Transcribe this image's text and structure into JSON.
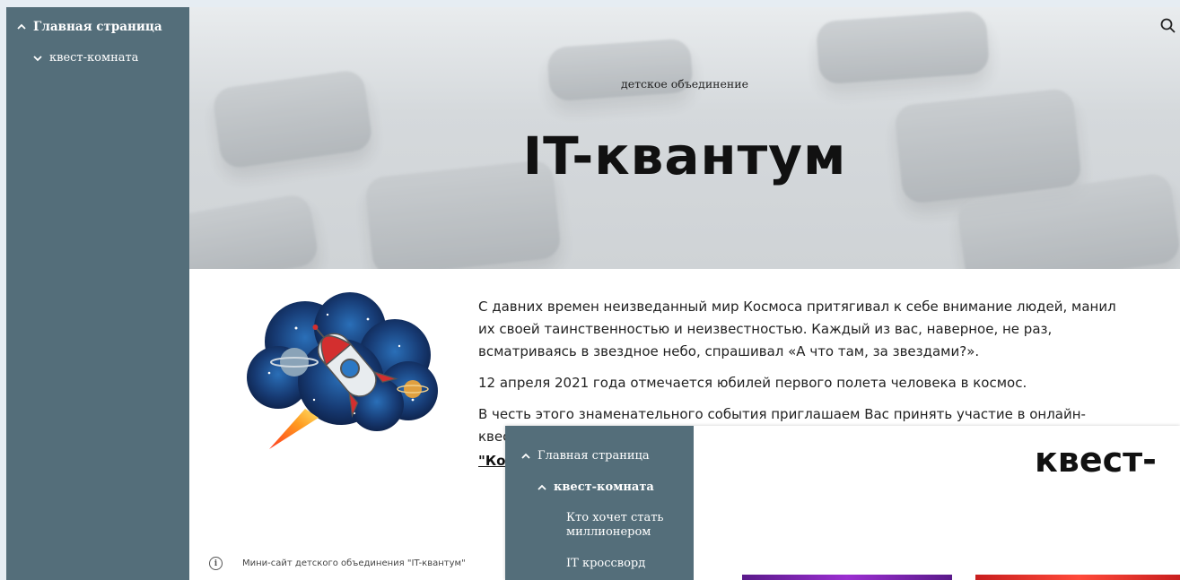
{
  "sidebar": {
    "home_label": "Главная страница",
    "quest_label": "квест-комната"
  },
  "hero": {
    "subtitle": "детское объединение",
    "title": "IT-квантум"
  },
  "content": {
    "paragraph1": "С давних времен неизведанный мир Космоса притягивал к себе внимание людей, манил их своей таинственностью и неизвестностью. Каждый из вас, наверное, не раз, всматриваясь в звездное небо, спрашивал «А что там, за звездами?».",
    "paragraph2": "12 апреля 2021 года отмечается юбилей первого полета человека в космос.",
    "paragraph3": "В честь этого знаменательного события приглашаем Вас принять участие в онлайн-квесте",
    "link_fragment": "\"Кос"
  },
  "footer": {
    "info_text": "Мини-сайт детского объединения \"IT-квантум\""
  },
  "overlay": {
    "home_label": "Главная страница",
    "quest_label": "квест-комната",
    "sub_item_1": "Кто хочет стать миллионером",
    "sub_item_2": "IT кроссворд",
    "title_fragment": "квест-"
  },
  "icons": {
    "search": "search-icon",
    "chevron_up": "chevron-up-icon",
    "chevron_down": "chevron-down-icon",
    "info": "info-icon"
  },
  "colors": {
    "sidebar_bg": "#546e7a",
    "page_bg": "#e6edf3"
  }
}
